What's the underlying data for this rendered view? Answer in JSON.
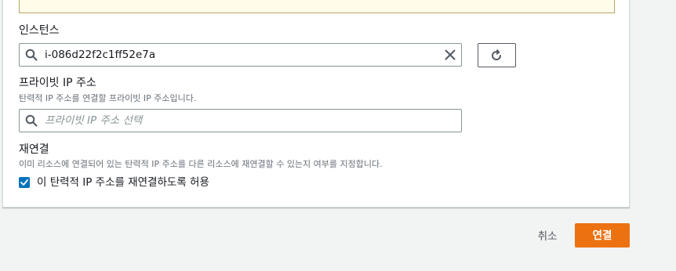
{
  "colors": {
    "primary_button": "#ec7211",
    "checkbox": "#0073bb",
    "warning_background": "#fffce9",
    "warning_border": "#b9a466"
  },
  "instance": {
    "label": "인스턴스",
    "value": "i-086d22f2c1ff52e7a",
    "search_icon": "search-icon",
    "clear_icon": "close-icon",
    "refresh_icon": "refresh-icon"
  },
  "private_ip": {
    "label": "프라이빗 IP 주소",
    "description": "탄력적 IP 주소를 연결할 프라이빗 IP 주소입니다.",
    "placeholder": "프라이빗 IP 주소 선택",
    "search_icon": "search-icon"
  },
  "reassociation": {
    "label": "재연결",
    "description": "이미 리소스에 연결되어 있는 탄력적 IP 주소를 다른 리소스에 재연결할 수 있는지 여부를 지정합니다.",
    "checkbox_label": "이 탄력적 IP 주소를 재연결하도록 허용",
    "checked": true
  },
  "actions": {
    "cancel_label": "취소",
    "connect_label": "연결"
  }
}
